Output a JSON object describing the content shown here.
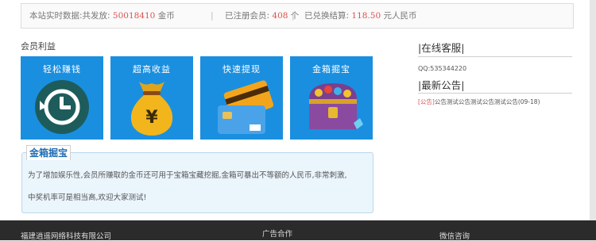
{
  "stats": {
    "issued_label": "本站实时数据:共发放:",
    "issued_value": "50018410",
    "issued_unit": "金币",
    "members_label": "已注册会员:",
    "members_value": "408",
    "members_unit": "个",
    "settled_label": "已兑换结算:",
    "settled_value": "118.50",
    "settled_unit": "元人民币",
    "separator": "|"
  },
  "benefits": {
    "title": "会员利益",
    "tiles": [
      {
        "label": "轻松赚钱",
        "icon": "clock-icon"
      },
      {
        "label": "超高收益",
        "icon": "money-bag-icon"
      },
      {
        "label": "快速提现",
        "icon": "credit-card-icon"
      },
      {
        "label": "金箱掘宝",
        "icon": "treasure-chest-icon"
      }
    ]
  },
  "info": {
    "title": "金箱掘宝",
    "line1": "为了增加娱乐性,会员所赚取的金币还可用于宝箱宝藏挖掘,金箱可暴出不等额的人民币,非常刺激,",
    "line2": "中奖机率可是相当高,欢迎大家测试!"
  },
  "sidebar": {
    "service_title": "|在线客服|",
    "qq": "QQ:535344220",
    "notice_title": "|最新公告|",
    "notice_tag": "[公告]",
    "notice_text": "公告测试公告测试公告测试公告(09-18)"
  },
  "footer": {
    "company": "福建逍遥网络科技有限公司",
    "ads": "广告合作",
    "wechat": "微信咨询"
  },
  "colors": {
    "tile_blue": "#1a8fe0",
    "number_red": "#d9534f",
    "footer_bg": "#2b2b2b"
  }
}
